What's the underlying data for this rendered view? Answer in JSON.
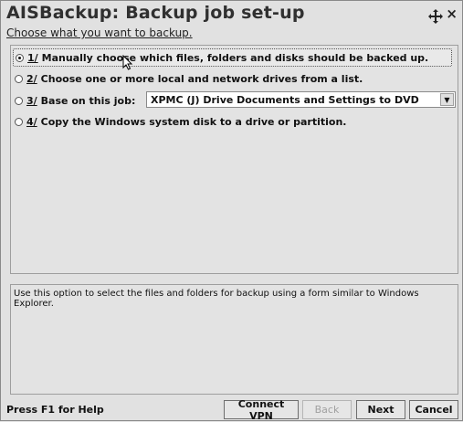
{
  "window": {
    "title": "AISBackup: Backup job set-up",
    "subtitle": "Choose what you want to backup."
  },
  "options": [
    {
      "num": "1/",
      "label": "Manually choose which files, folders and disks should be backed up.",
      "selected": true
    },
    {
      "num": "2/",
      "label": "Choose one or more local and network drives from a list.",
      "selected": false
    },
    {
      "num": "3/",
      "label": "Base on this job:",
      "selected": false
    },
    {
      "num": "4/",
      "label": "Copy the Windows system disk to a drive or partition.",
      "selected": false
    }
  ],
  "job_select": {
    "value": "XPMC (J) Drive Documents and Settings to DVD"
  },
  "description": "Use this option to select the files and folders for backup using a form similar to Windows Explorer.",
  "status": {
    "help": "Press F1 for Help"
  },
  "buttons": {
    "connect_vpn": "Connect VPN",
    "back": "Back",
    "next": "Next",
    "cancel": "Cancel"
  }
}
